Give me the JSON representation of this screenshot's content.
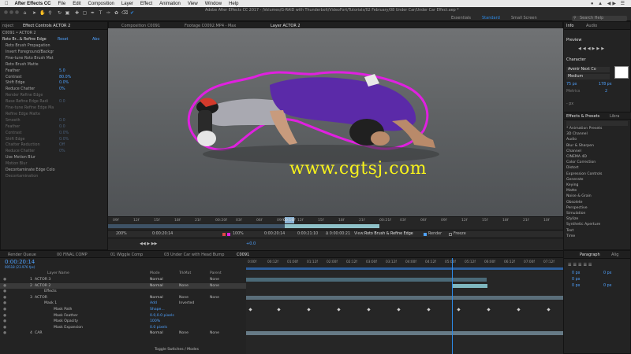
{
  "menubar": {
    "app": "After Effects CC",
    "items": [
      "File",
      "Edit",
      "Composition",
      "Layer",
      "Effect",
      "Animation",
      "View",
      "Window",
      "Help"
    ]
  },
  "window_title": "Adobe After Effects CC 2017 - /Volumes/G-RAID with Thunderbolt/VideoFort/Tutorials/02 February/08 Under Car/Under Car Effect.aep *",
  "workspaces": [
    "Essentials",
    "Standard",
    "Small Screen"
  ],
  "search_placeholder": "Search Help",
  "project_panel": {
    "tab": "roject"
  },
  "effect_controls": {
    "tab": "Effect Controls ACTOR 2",
    "header_left": "C0091 • ACTOR 2",
    "effect_name": "Roto Br...& Refine Edge",
    "reset": "Reset",
    "about": "Abo",
    "rows": [
      {
        "label": "Roto Brush Propagation",
        "value": "",
        "dim": false
      },
      {
        "label": "Invert Foreground/Backgr",
        "value": "",
        "dim": false
      },
      {
        "label": "Fine-tune Roto Brush Mat",
        "value": "",
        "dim": false
      },
      {
        "label": "Roto Brush Matte",
        "value": "",
        "dim": false
      },
      {
        "label": "Feather",
        "value": "5.0",
        "dim": false
      },
      {
        "label": "Contrast",
        "value": "80.0%",
        "dim": false
      },
      {
        "label": "Shift Edge",
        "value": "0.0%",
        "dim": false
      },
      {
        "label": "Reduce Chatter",
        "value": "0%",
        "dim": false
      },
      {
        "label": "Render Refine Edge",
        "value": "",
        "dim": true
      },
      {
        "label": "Base Refine Edge Radi",
        "value": "0.0",
        "dim": true
      },
      {
        "label": "Fine-tune Refine Edge Ma",
        "value": "",
        "dim": true
      },
      {
        "label": "Refine Edge Matte",
        "value": "",
        "dim": true
      },
      {
        "label": "Smooth",
        "value": "0.0",
        "dim": true
      },
      {
        "label": "Feather",
        "value": "0.0",
        "dim": true
      },
      {
        "label": "Contrast",
        "value": "0.0%",
        "dim": true
      },
      {
        "label": "Shift Edge",
        "value": "0.0%",
        "dim": true
      },
      {
        "label": "Chatter Reduction",
        "value": "Off",
        "dim": true
      },
      {
        "label": "Reduce Chatter",
        "value": "0%",
        "dim": true
      },
      {
        "label": "Use Motion Blur",
        "value": "",
        "dim": false
      },
      {
        "label": "Motion Blur",
        "value": "",
        "dim": true
      },
      {
        "label": "Decontaminate Edge Colo",
        "value": "",
        "dim": false
      },
      {
        "label": "Decontamination",
        "value": "",
        "dim": true
      }
    ]
  },
  "viewer_tabs": [
    "Composition C0091",
    "Footage C0092.MP4 - Max",
    "Layer ACTOR 2"
  ],
  "watermark": "www.cgtsj.com",
  "layer_ruler": [
    "09f",
    "12f",
    "15f",
    "18f",
    "21f",
    "00:20f",
    "03f",
    "06f",
    "09f",
    "12f",
    "15f",
    "18f",
    "21f",
    "00:21f",
    "03f",
    "06f",
    "09f",
    "12f",
    "15f",
    "18f",
    "21f",
    "10f"
  ],
  "layer_ruler_current": "00:16F",
  "viewer_bar": {
    "zoom": "200%",
    "timecode": "0:00:20:14",
    "res": "100%",
    "in_time": "0:00:20:14",
    "out_time": "0:00:21:10",
    "duration": "Δ 0:00:00:21",
    "view_label": "View:",
    "view_value": "Roto Brush & Refine Edge",
    "render": "Render",
    "freeze": "Freeze",
    "current_offset": "+0.0"
  },
  "right_panel": {
    "info_tabs": [
      "Info",
      "Audio"
    ],
    "preview": "Preview",
    "character": "Character",
    "font_name": "Avenir Next Co",
    "font_style": "Medium",
    "font_size": "75 px",
    "leading": "178 px",
    "tracking_label": "Metrics",
    "tracking_value": "2",
    "px_unit": "- px",
    "effects_tabs": [
      "Effects & Presets",
      "Libra"
    ],
    "effects": [
      "* Animation Presets",
      "3D Channel",
      "Audio",
      "Blur & Sharpen",
      "Channel",
      "CINEMA 4D",
      "Color Correction",
      "Distort",
      "Expression Controls",
      "Generate",
      "Keying",
      "Matte",
      "Noise & Grain",
      "Obsolete",
      "Perspective",
      "Simulation",
      "Stylize",
      "Synthetic Aperture",
      "Text",
      "Time"
    ]
  },
  "timeline_tabs": [
    "Render Queue",
    "00 FINAL COMP",
    "01 Wiggle Comp",
    "03 Under Car with Head Bump",
    "C0091"
  ],
  "timecode": "0:00:20:14",
  "timecode_sub": "00518 (23.976 fps)",
  "columns": {
    "name": "Layer Name",
    "mode": "Mode",
    "trkmat": "TrkMat",
    "parent": "Parent"
  },
  "layers": [
    {
      "num": "1",
      "name": "ACTOR 3",
      "mode": "Normal",
      "trk": "",
      "parent": "None"
    },
    {
      "num": "2",
      "name": "ACTOR 2",
      "mode": "Normal",
      "trk": "None",
      "parent": "None"
    },
    {
      "num": "",
      "name": "Effects",
      "mode": "",
      "trk": "",
      "parent": ""
    },
    {
      "num": "3",
      "name": "ACTOR",
      "mode": "Normal",
      "trk": "None",
      "parent": "None"
    },
    {
      "num": "",
      "name": "Mask 1",
      "mode": "Add",
      "trk": "Inverted",
      "parent": ""
    },
    {
      "num": "",
      "name": "Mask Path",
      "mode": "Shape...",
      "trk": "",
      "parent": ""
    },
    {
      "num": "",
      "name": "Mask Feather",
      "mode": "0.0,0.0 pixels",
      "trk": "",
      "parent": ""
    },
    {
      "num": "",
      "name": "Mask Opacity",
      "mode": "100%",
      "trk": "",
      "parent": ""
    },
    {
      "num": "",
      "name": "Mask Expansion",
      "mode": "0.0 pixels",
      "trk": "",
      "parent": ""
    },
    {
      "num": "4",
      "name": "CAR",
      "mode": "Normal",
      "trk": "None",
      "parent": "None"
    }
  ],
  "time_ruler": [
    "0:00f",
    "00:12f",
    "01:00f",
    "01:12f",
    "02:00f",
    "02:12f",
    "03:00f",
    "03:12f",
    "04:00f",
    "04:12f",
    "05:00f",
    "05:12f",
    "06:00f",
    "06:12f",
    "07:00f",
    "07:12f"
  ],
  "footer": "Toggle Switches / Modes",
  "paragraph": {
    "tabs": [
      "Paragraph",
      "Alig"
    ],
    "values": [
      "0 px",
      "0 px",
      "0 px",
      "0 px",
      "0 px"
    ]
  },
  "colors": {
    "accent": "#2d8ceb",
    "rotoOutline": "#e020e0",
    "watermark": "#f7f21b",
    "shirt": "#5b2aa8"
  }
}
